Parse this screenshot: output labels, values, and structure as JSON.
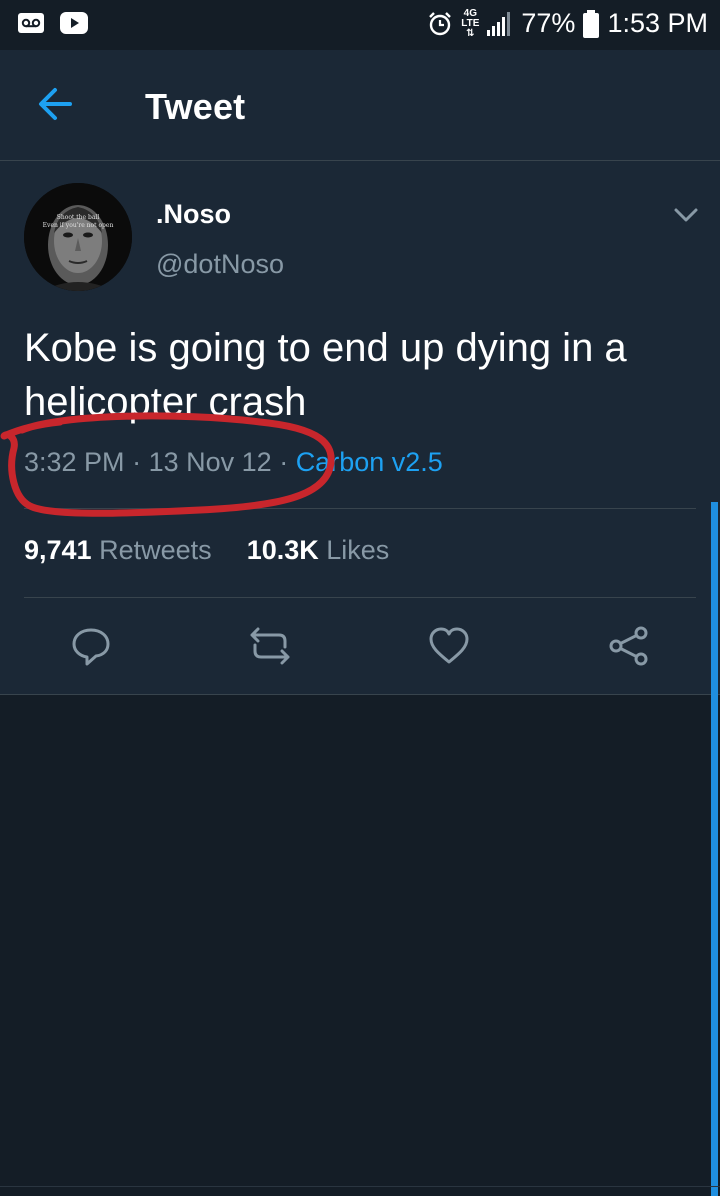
{
  "status_bar": {
    "battery": "77%",
    "time": "1:53 PM",
    "network": "4G LTE"
  },
  "header": {
    "title": "Tweet"
  },
  "tweet": {
    "display_name": ".Noso",
    "handle": "@dotNoso",
    "text": "Kobe is going to end up dying in a helicopter crash",
    "time": "3:32 PM",
    "date": "13 Nov 12",
    "source": "Carbon v2.5",
    "retweets_count": "9,741",
    "retweets_label": "Retweets",
    "likes_count": "10.3K",
    "likes_label": "Likes",
    "avatar_caption_1": "Shoot the ball",
    "avatar_caption_2": "Even if you're not open"
  },
  "colors": {
    "background": "#141d26",
    "card": "#1b2836",
    "accent": "#1da1f2",
    "muted": "#8899a6",
    "annotation": "#c8262c"
  },
  "icons": [
    "voicemail-icon",
    "youtube-icon",
    "alarm-icon",
    "network-4g-icon",
    "signal-icon",
    "battery-icon",
    "back-arrow-icon",
    "chevron-down-icon",
    "reply-icon",
    "retweet-icon",
    "like-icon",
    "share-icon"
  ]
}
